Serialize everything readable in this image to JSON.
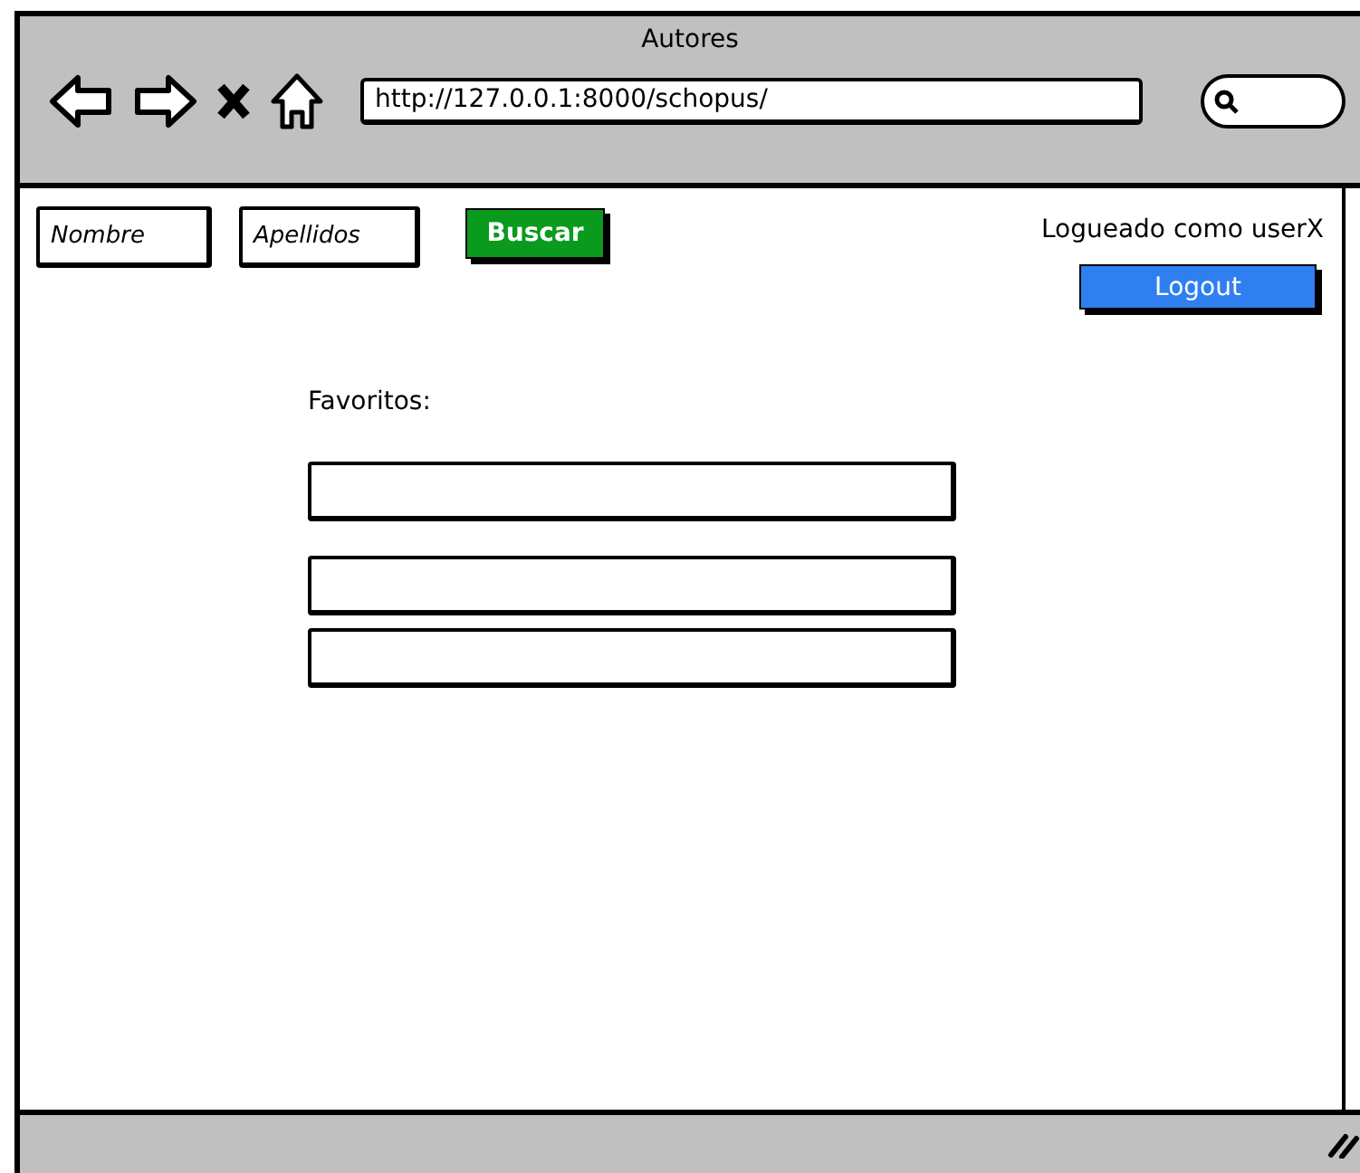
{
  "window": {
    "title": "Autores"
  },
  "browser": {
    "url": "http://127.0.0.1:8000/schopus/"
  },
  "search_form": {
    "fields": [
      {
        "placeholder": "Nombre"
      },
      {
        "placeholder": "Apellidos"
      }
    ],
    "button": "Buscar"
  },
  "user": {
    "status": "Logueado como userX",
    "logout": "Logout"
  },
  "favorites": {
    "label": "Favoritos:"
  }
}
